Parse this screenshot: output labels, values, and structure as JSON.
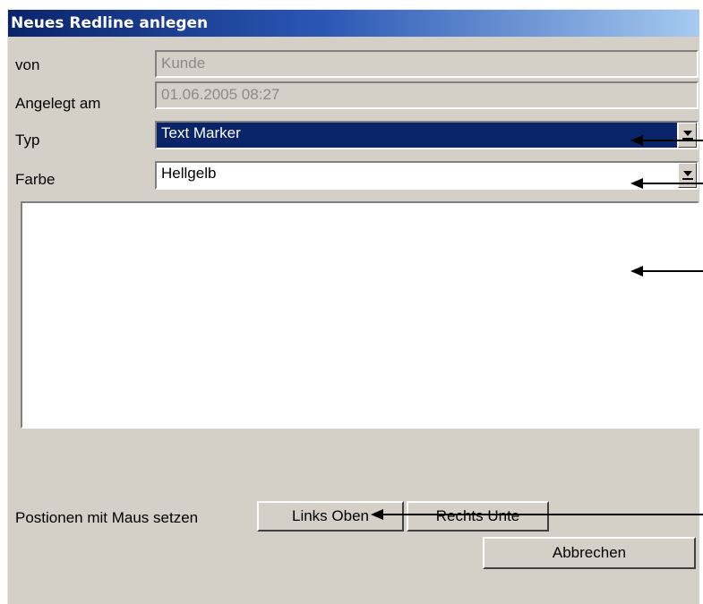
{
  "dialog": {
    "title": "Neues Redline anlegen",
    "fields": {
      "von": {
        "label": "von",
        "value": "Kunde"
      },
      "angelegt": {
        "label": "Angelegt am",
        "value": "01.06.2005 08:27"
      },
      "typ": {
        "label": "Typ",
        "value": "Text Marker"
      },
      "farbe": {
        "label": "Farbe",
        "value": "Hellgelb"
      }
    },
    "comment": "",
    "position": {
      "label": "Postionen mit Maus setzen",
      "links_oben": "Links Oben",
      "rechts_unten": "Rechts Unte"
    },
    "cancel_label": "Abbrechen"
  },
  "colors": {
    "title_start": "#0a246a",
    "title_end": "#a6caf0",
    "face": "#d4d0c8",
    "selection": "#0a246a"
  }
}
